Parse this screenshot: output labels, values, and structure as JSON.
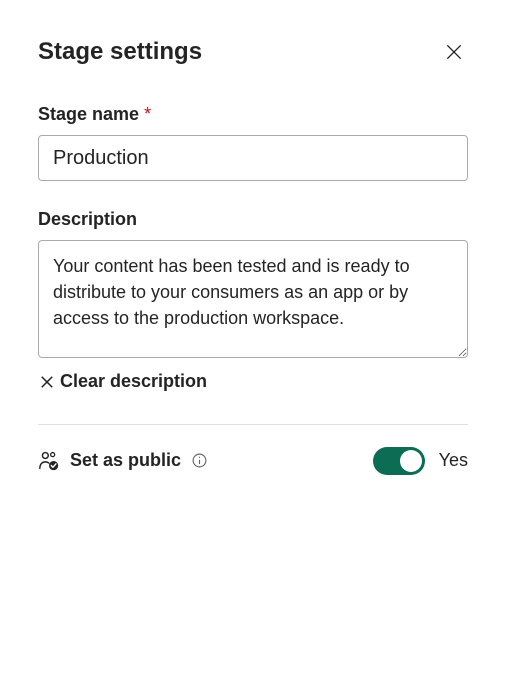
{
  "header": {
    "title": "Stage settings"
  },
  "fields": {
    "stageName": {
      "label": "Stage name",
      "required": "*",
      "value": "Production"
    },
    "description": {
      "label": "Description",
      "value": "Your content has been tested and is ready to distribute to your consumers as an app or by access to the production workspace.",
      "clear": "Clear description"
    }
  },
  "setPublic": {
    "label": "Set as public",
    "stateLabel": "Yes"
  }
}
